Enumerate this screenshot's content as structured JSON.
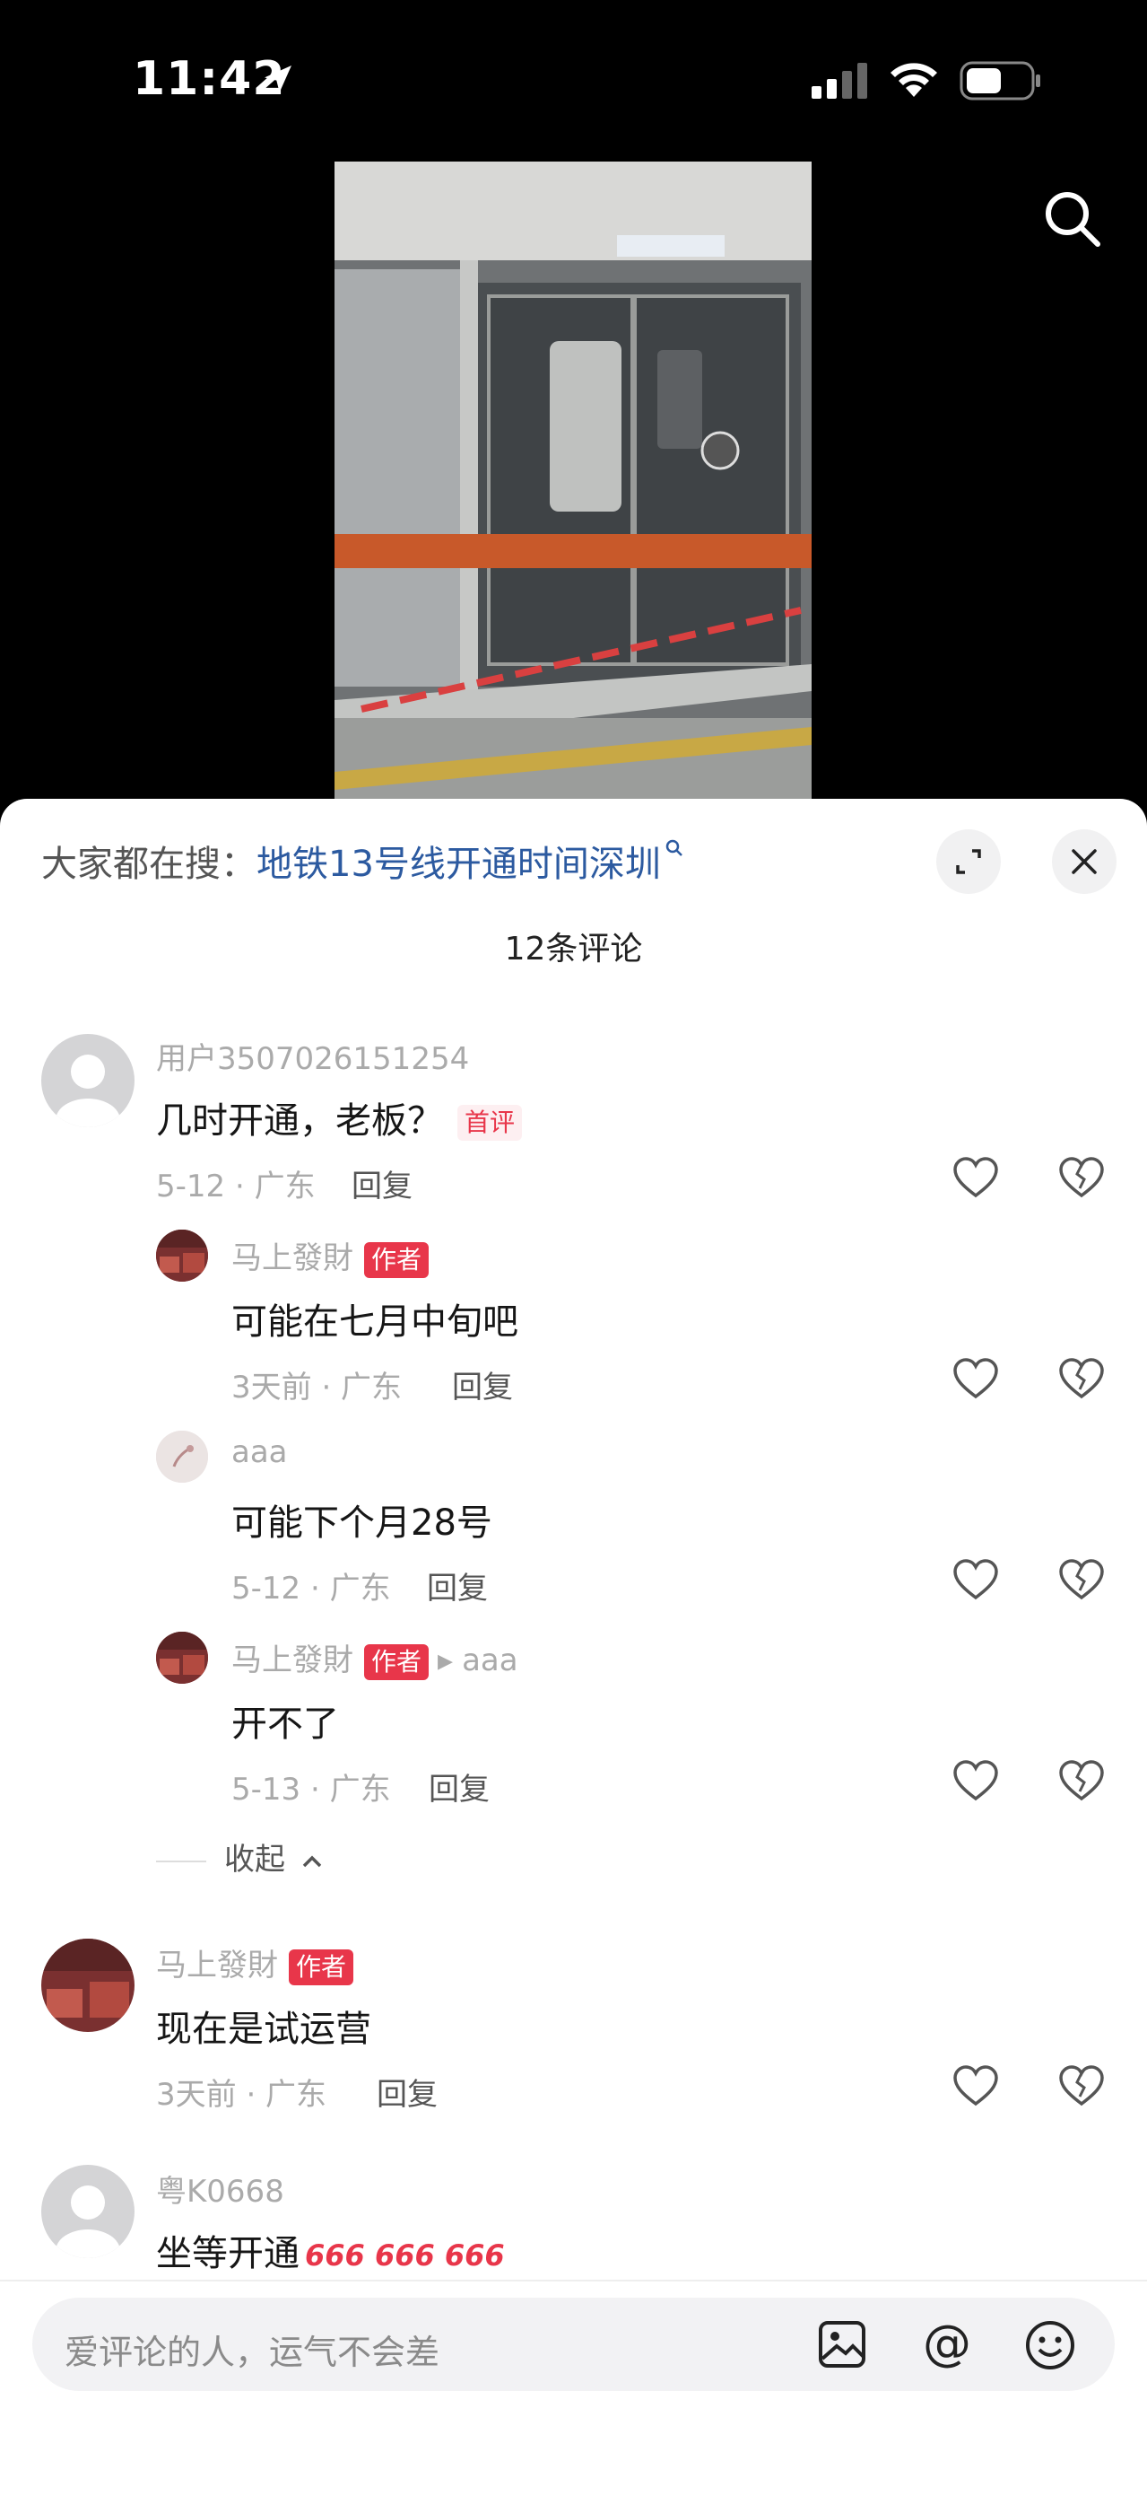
{
  "status_bar": {
    "time": "11:42"
  },
  "hot_search": {
    "prefix": "大家都在搜：",
    "query": "地铁13号线开通时间深圳"
  },
  "comment_count": "12条评论",
  "comments": [
    {
      "user": "用户3507026151254",
      "text": "几时开通，老板？",
      "badge": "首评",
      "meta": "5-12 · 广东",
      "reply": "回复",
      "replies": [
        {
          "user": "马上發財",
          "badge": "作者",
          "text": "可能在七月中旬吧",
          "meta": "3天前 · 广东",
          "reply": "回复"
        },
        {
          "user": "aaa",
          "text": "可能下个月28号",
          "meta": "5-12 · 广东",
          "reply": "回复"
        },
        {
          "user": "马上發財",
          "badge": "作者",
          "reply_to": "aaa",
          "text": "开不了",
          "meta": "5-13 · 广东",
          "reply": "回复"
        }
      ],
      "collapse": "收起"
    },
    {
      "user": "马上發財",
      "badge": "作者",
      "text": "现在是试运营",
      "meta": "3天前 · 广东",
      "reply": "回复"
    },
    {
      "user": "粤K0668",
      "text": "坐等开通",
      "emoji": "666 666 666"
    }
  ],
  "input": {
    "placeholder": "爱评论的人，运气不会差"
  },
  "colors": {
    "author_badge": "#e8364a",
    "link": "#2c5aa0"
  }
}
